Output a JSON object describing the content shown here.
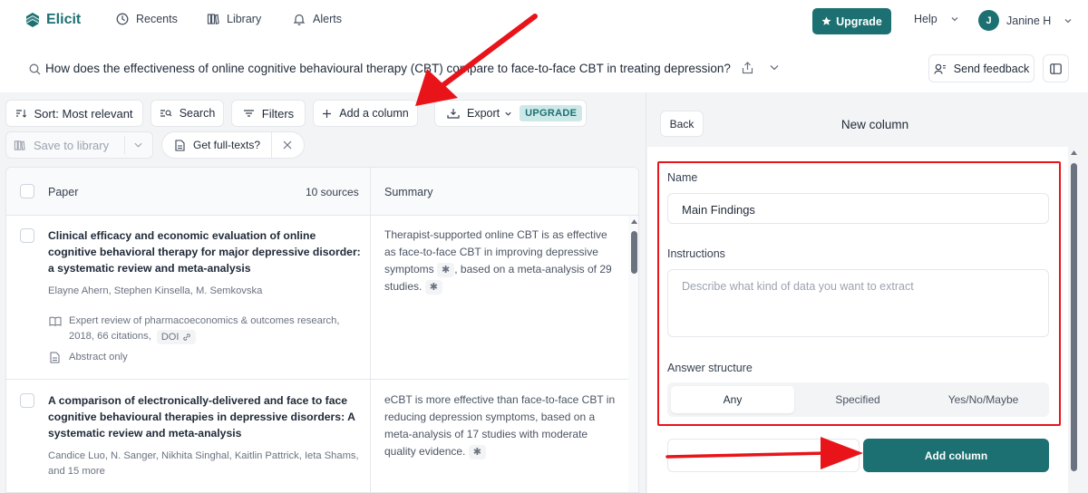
{
  "app": {
    "name": "Elicit",
    "colors": {
      "brand": "#1c7072",
      "annotation": "#e8141a",
      "accent_text": "#1f2937"
    }
  },
  "nav": {
    "recents": "Recents",
    "library": "Library",
    "alerts": "Alerts",
    "upgrade": "Upgrade",
    "help": "Help",
    "user_initial": "J",
    "user_name": "Janine H"
  },
  "query": {
    "text": "How does the effectiveness of online cognitive behavioural therapy (CBT) compare to face-to-face CBT in treating depression?",
    "send_feedback": "Send feedback"
  },
  "toolbar": {
    "sort": "Sort: Most relevant",
    "search": "Search",
    "filters": "Filters",
    "add_column": "Add a column",
    "export": "Export",
    "upgrade_badge": "UPGRADE",
    "save_to_library": "Save to library",
    "get_full_texts": "Get full-texts?"
  },
  "table": {
    "col_paper": "Paper",
    "sources": "10 sources",
    "col_summary": "Summary",
    "rows": [
      {
        "title": "Clinical efficacy and economic evaluation of online cognitive behavioral therapy for major depressive disorder: a systematic review and meta-analysis",
        "authors": "Elayne Ahern, Stephen Kinsella, M. Semkovska",
        "journal": "Expert review of pharmacoeconomics & outcomes research,",
        "year_citations": "2018, 66 citations,",
        "doi": "DOI",
        "abstract": "Abstract only",
        "summary": "Therapist-supported online CBT is as effective as face-to-face CBT in improving depressive symptoms",
        "summary_tail": ", based on a meta-analysis of 29 studies."
      },
      {
        "title": "A comparison of electronically-delivered and face to face cognitive behavioural therapies in depressive disorders: A systematic review and meta-analysis",
        "authors": "Candice Luo, N. Sanger, Nikhita Singhal, Kaitlin Pattrick, Ieta Shams,",
        "authors_more": "and 15 more",
        "summary": "eCBT is more effective than face-to-face CBT in reducing depression symptoms, based on a meta-analysis of 17 studies with moderate quality evidence."
      }
    ]
  },
  "panel": {
    "back": "Back",
    "title": "New column",
    "name_label": "Name",
    "name_value": "Main Findings",
    "instructions_label": "Instructions",
    "instructions_placeholder": "Describe what kind of data you want to extract",
    "answer_structure_label": "Answer structure",
    "options": [
      "Any",
      "Specified",
      "Yes/No/Maybe"
    ],
    "selected_option": "Any",
    "add_column": "Add column"
  }
}
